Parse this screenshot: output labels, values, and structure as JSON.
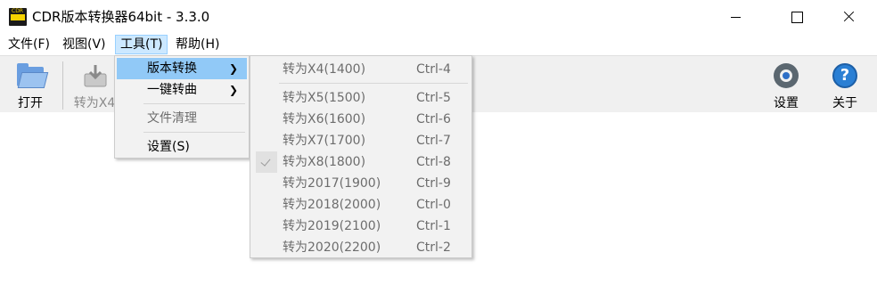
{
  "window": {
    "title": "CDR版本转换器64bit - 3.3.0",
    "icon_text": "CDR"
  },
  "menubar": {
    "items": [
      {
        "label": "文件(F)"
      },
      {
        "label": "视图(V)"
      },
      {
        "label": "工具(T)",
        "active": true
      },
      {
        "label": "帮助(H)"
      }
    ]
  },
  "toolbar": {
    "open_label": "打开",
    "convert_label": "转为X4",
    "settings_label": "设置",
    "about_label": "关于"
  },
  "tools_menu": {
    "items": [
      {
        "label": "版本转换",
        "submenu": true,
        "highlighted": true
      },
      {
        "label": "一键转曲",
        "submenu": true
      },
      {
        "label": "文件清理",
        "disabled": true
      },
      {
        "label": "设置(S)"
      }
    ]
  },
  "version_submenu": {
    "items": [
      {
        "label": "转为X4(1400)",
        "shortcut": "Ctrl-4"
      },
      {
        "label": "转为X5(1500)",
        "shortcut": "Ctrl-5"
      },
      {
        "label": "转为X6(1600)",
        "shortcut": "Ctrl-6"
      },
      {
        "label": "转为X7(1700)",
        "shortcut": "Ctrl-7"
      },
      {
        "label": "转为X8(1800)",
        "shortcut": "Ctrl-8",
        "checked": true
      },
      {
        "label": "转为2017(1900)",
        "shortcut": "Ctrl-9"
      },
      {
        "label": "转为2018(2000)",
        "shortcut": "Ctrl-0"
      },
      {
        "label": "转为2019(2100)",
        "shortcut": "Ctrl-1"
      },
      {
        "label": "转为2020(2200)",
        "shortcut": "Ctrl-2"
      }
    ]
  },
  "icons": {
    "open": "folder-open-icon",
    "convert": "convert-icon",
    "settings": "gear-icon",
    "about": "help-icon",
    "submenu_arrow": "chevron-right-icon",
    "check": "check-icon"
  },
  "colors": {
    "menu_highlight": "#91c9f7",
    "menubar_active": "#cce8ff",
    "toolbar_bg": "#f0f0f0",
    "disabled_text": "#6d6d6d"
  }
}
